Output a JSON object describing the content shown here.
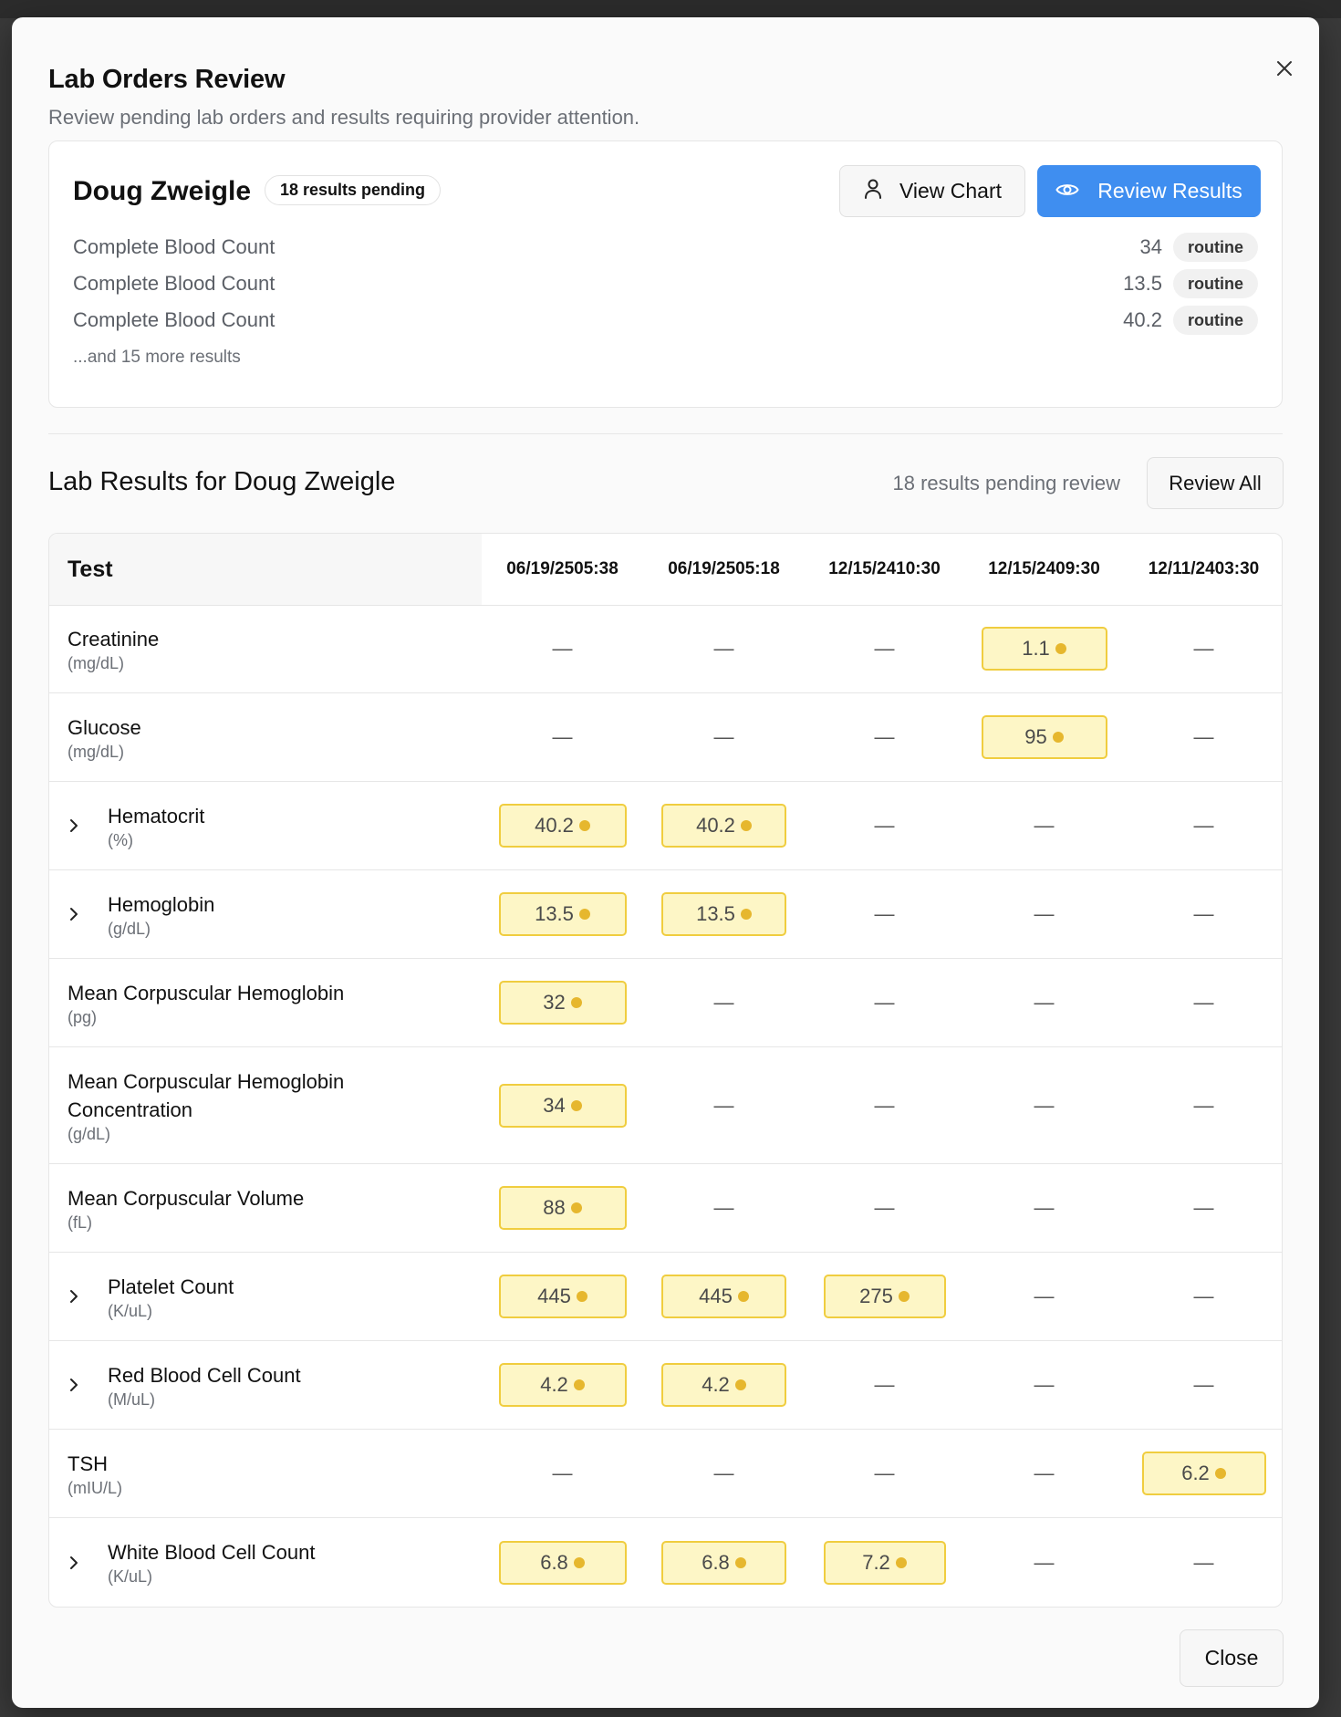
{
  "modal": {
    "title": "Lab Orders Review",
    "subtitle": "Review pending lab orders and results requiring provider attention.",
    "close_icon": "close-icon"
  },
  "patient": {
    "name": "Doug Zweigle",
    "pending_badge": "18 results pending",
    "view_chart_label": "View Chart",
    "review_results_label": "Review Results",
    "orders": [
      {
        "name": "Complete Blood Count",
        "value": "34",
        "priority": "routine"
      },
      {
        "name": "Complete Blood Count",
        "value": "13.5",
        "priority": "routine"
      },
      {
        "name": "Complete Blood Count",
        "value": "40.2",
        "priority": "routine"
      }
    ],
    "more_text": "...and 15 more results"
  },
  "results": {
    "title": "Lab Results for Doug Zweigle",
    "pending_text": "18 results pending review",
    "review_all_label": "Review All",
    "test_header": "Test",
    "dates": [
      "06/19/2505:38",
      "06/19/2505:18",
      "12/15/2410:30",
      "12/15/2409:30",
      "12/11/2403:30"
    ],
    "rows": [
      {
        "name": "Creatinine",
        "unit": "(mg/dL)",
        "expandable": false,
        "values": [
          "—",
          "—",
          "—",
          "1.1",
          "—"
        ]
      },
      {
        "name": "Glucose",
        "unit": "(mg/dL)",
        "expandable": false,
        "values": [
          "—",
          "—",
          "—",
          "95",
          "—"
        ]
      },
      {
        "name": "Hematocrit",
        "unit": "(%)",
        "expandable": true,
        "values": [
          "40.2",
          "40.2",
          "—",
          "—",
          "—"
        ]
      },
      {
        "name": "Hemoglobin",
        "unit": "(g/dL)",
        "expandable": true,
        "values": [
          "13.5",
          "13.5",
          "—",
          "—",
          "—"
        ]
      },
      {
        "name": "Mean Corpuscular Hemoglobin",
        "unit": "(pg)",
        "expandable": false,
        "values": [
          "32",
          "—",
          "—",
          "—",
          "—"
        ]
      },
      {
        "name": "Mean Corpuscular Hemoglobin Concentration",
        "unit": "(g/dL)",
        "expandable": false,
        "values": [
          "34",
          "—",
          "—",
          "—",
          "—"
        ]
      },
      {
        "name": "Mean Corpuscular Volume",
        "unit": "(fL)",
        "expandable": false,
        "values": [
          "88",
          "—",
          "—",
          "—",
          "—"
        ]
      },
      {
        "name": "Platelet Count",
        "unit": "(K/uL)",
        "expandable": true,
        "values": [
          "445",
          "445",
          "275",
          "—",
          "—"
        ]
      },
      {
        "name": "Red Blood Cell Count",
        "unit": "(M/uL)",
        "expandable": true,
        "values": [
          "4.2",
          "4.2",
          "—",
          "—",
          "—"
        ]
      },
      {
        "name": "TSH",
        "unit": "(mIU/L)",
        "expandable": false,
        "values": [
          "—",
          "—",
          "—",
          "—",
          "6.2"
        ]
      },
      {
        "name": "White Blood Cell Count",
        "unit": "(K/uL)",
        "expandable": true,
        "values": [
          "6.8",
          "6.8",
          "7.2",
          "—",
          "—"
        ]
      }
    ]
  },
  "footer": {
    "close_label": "Close"
  },
  "colors": {
    "accent": "#3f8ef0",
    "pending_bg": "#fdf6c6",
    "pending_border": "#f0cd3f",
    "pending_dot": "#e6b72e"
  }
}
